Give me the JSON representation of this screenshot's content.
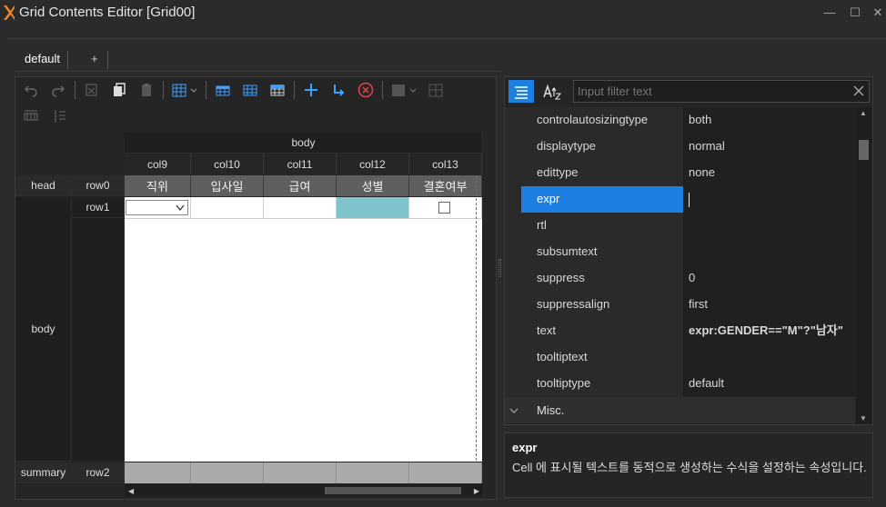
{
  "window": {
    "title": "Grid Contents Editor [Grid00]",
    "minimize": "—",
    "maximize": "☐",
    "close": "✕"
  },
  "tabs": [
    {
      "label": "default",
      "active": true
    },
    {
      "label": "+",
      "active": false
    }
  ],
  "grid": {
    "band_label": "body",
    "columns": [
      "col9",
      "col10",
      "col11",
      "col12",
      "col13"
    ],
    "row_bands": {
      "head": "head",
      "body": "body",
      "summary": "summary"
    },
    "rows": {
      "head": "row0",
      "body": "row1",
      "summary": "row2"
    },
    "head_cells": [
      "직위",
      "입사일",
      "급여",
      "성별",
      "결혼여부"
    ]
  },
  "property_panel": {
    "filter_placeholder": "Input filter text",
    "properties": [
      {
        "name": "controlautosizingtype",
        "value": "both"
      },
      {
        "name": "displaytype",
        "value": "normal"
      },
      {
        "name": "edittype",
        "value": "none"
      },
      {
        "name": "expr",
        "value": "",
        "selected": true
      },
      {
        "name": "rtl",
        "value": ""
      },
      {
        "name": "subsumtext",
        "value": ""
      },
      {
        "name": "suppress",
        "value": "0"
      },
      {
        "name": "suppressalign",
        "value": "first"
      },
      {
        "name": "text",
        "value": "expr:GENDER==\"M\"?\"남자\"",
        "bold": true
      },
      {
        "name": "tooltiptext",
        "value": ""
      },
      {
        "name": "tooltiptype",
        "value": "default"
      }
    ],
    "category": "Misc.",
    "description_title": "expr",
    "description_text": "Cell 에 표시될 텍스트를 동적으로 생성하는 수식을 설정하는 속성입니다."
  },
  "colors": {
    "accent": "#1e7fe2",
    "selected_cell": "#7fc3cc",
    "head_cell": "#5f5f5f",
    "summary_cell": "#aaaaaa"
  }
}
